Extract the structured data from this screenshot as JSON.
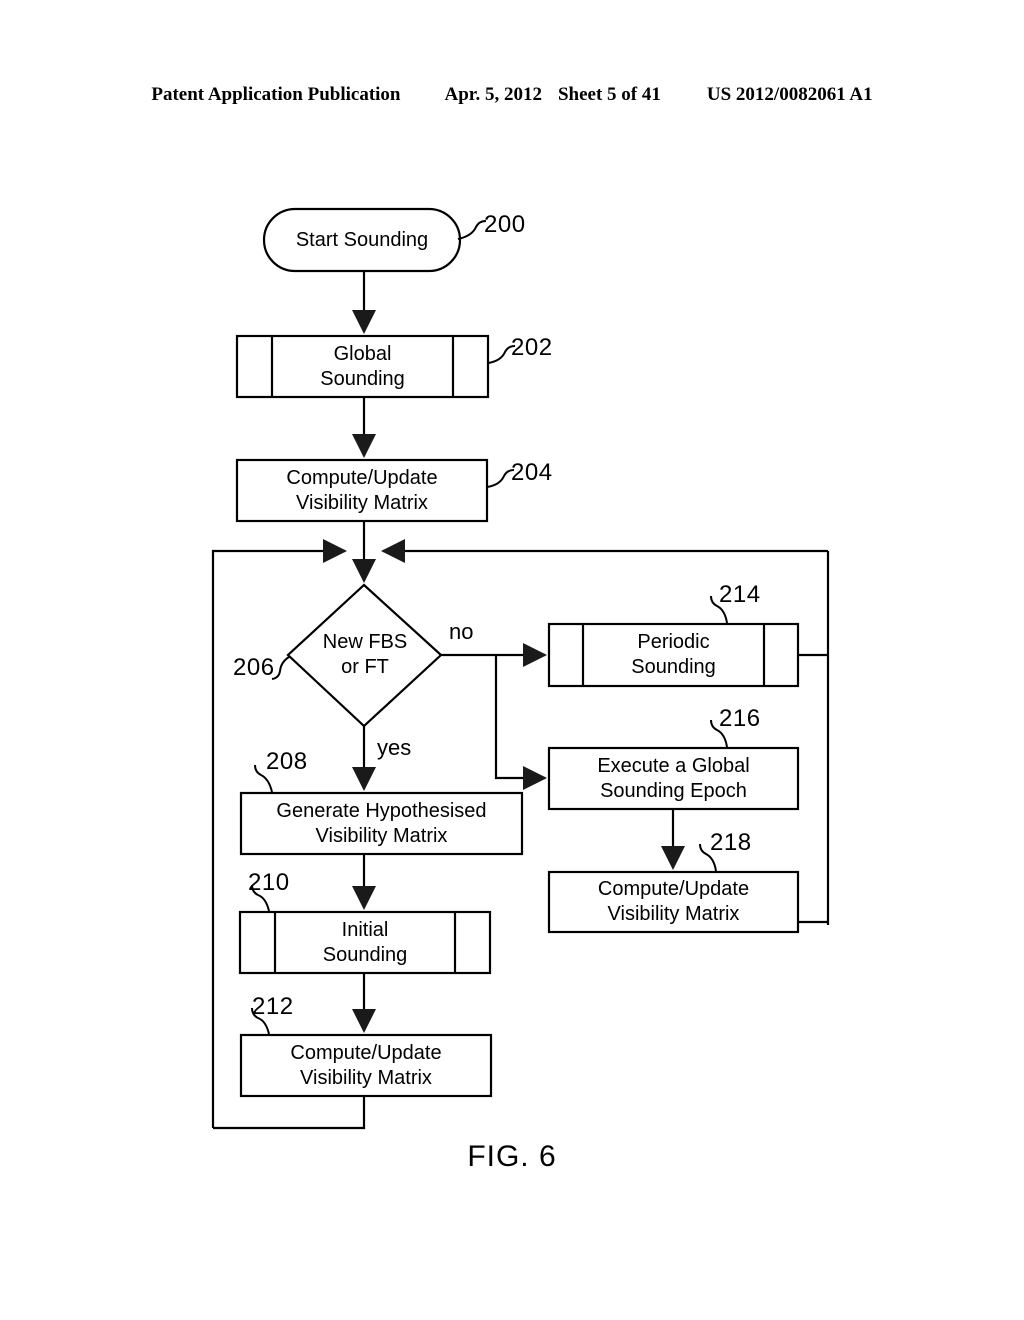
{
  "header": {
    "publication": "Patent Application Publication",
    "date": "Apr. 5, 2012",
    "sheet": "Sheet 5 of 41",
    "patent_number": "US 2012/0082061 A1"
  },
  "figure": {
    "caption": "FIG. 6",
    "colors": {
      "stroke": "#000000",
      "fill": "#ffffff"
    },
    "nodes": [
      {
        "id": "n200",
        "ref": "200",
        "label": "Start Sounding",
        "shape": "terminator"
      },
      {
        "id": "n202",
        "ref": "202",
        "label": "Global\nSounding",
        "shape": "predefined-process"
      },
      {
        "id": "n204",
        "ref": "204",
        "label": "Compute/Update\nVisibility Matrix",
        "shape": "process"
      },
      {
        "id": "n206",
        "ref": "206",
        "label": "New FBS\nor FT",
        "shape": "decision"
      },
      {
        "id": "n208",
        "ref": "208",
        "label": "Generate Hypothesised\nVisibility Matrix",
        "shape": "process"
      },
      {
        "id": "n210",
        "ref": "210",
        "label": "Initial\nSounding",
        "shape": "predefined-process"
      },
      {
        "id": "n212",
        "ref": "212",
        "label": "Compute/Update\nVisibility Matrix",
        "shape": "process"
      },
      {
        "id": "n214",
        "ref": "214",
        "label": "Periodic\nSounding",
        "shape": "predefined-process"
      },
      {
        "id": "n216",
        "ref": "216",
        "label": "Execute a Global\nSounding Epoch",
        "shape": "process"
      },
      {
        "id": "n218",
        "ref": "218",
        "label": "Compute/Update\nVisibility Matrix",
        "shape": "process"
      }
    ],
    "edge_labels": [
      {
        "id": "e-no",
        "text": "no"
      },
      {
        "id": "e-yes",
        "text": "yes"
      }
    ]
  }
}
